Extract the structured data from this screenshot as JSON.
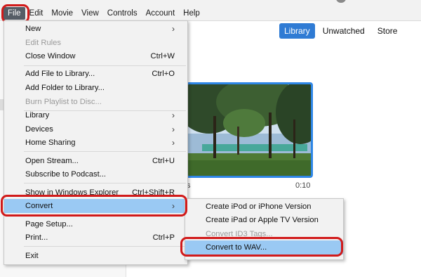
{
  "menubar": {
    "items": [
      "File",
      "Edit",
      "Movie",
      "View",
      "Controls",
      "Account",
      "Help"
    ]
  },
  "library_nav": {
    "tabs": [
      "Library",
      "Unwatched",
      "Store"
    ],
    "active": "Library"
  },
  "video": {
    "title_fragment": "s",
    "duration": "0:10"
  },
  "file_menu": {
    "items": [
      {
        "label": "New",
        "shortcut": "",
        "submenu": true,
        "disabled": false
      },
      {
        "label": "Edit Rules",
        "shortcut": "",
        "submenu": false,
        "disabled": true
      },
      {
        "label": "Close Window",
        "shortcut": "Ctrl+W",
        "submenu": false,
        "disabled": false
      },
      {
        "label": "Add File to Library...",
        "shortcut": "Ctrl+O",
        "submenu": false,
        "disabled": false
      },
      {
        "label": "Add Folder to Library...",
        "shortcut": "",
        "submenu": false,
        "disabled": false
      },
      {
        "label": "Burn Playlist to Disc...",
        "shortcut": "",
        "submenu": false,
        "disabled": true
      },
      {
        "label": "Library",
        "shortcut": "",
        "submenu": true,
        "disabled": false
      },
      {
        "label": "Devices",
        "shortcut": "",
        "submenu": true,
        "disabled": false
      },
      {
        "label": "Home Sharing",
        "shortcut": "",
        "submenu": true,
        "disabled": false
      },
      {
        "label": "Open Stream...",
        "shortcut": "Ctrl+U",
        "submenu": false,
        "disabled": false
      },
      {
        "label": "Subscribe to Podcast...",
        "shortcut": "",
        "submenu": false,
        "disabled": false
      },
      {
        "label": "Show in Windows Explorer",
        "shortcut": "Ctrl+Shift+R",
        "submenu": false,
        "disabled": false
      },
      {
        "label": "Convert",
        "shortcut": "",
        "submenu": true,
        "disabled": false,
        "highlighted": true
      },
      {
        "label": "Page Setup...",
        "shortcut": "",
        "submenu": false,
        "disabled": false
      },
      {
        "label": "Print...",
        "shortcut": "Ctrl+P",
        "submenu": false,
        "disabled": false
      },
      {
        "label": "Exit",
        "shortcut": "",
        "submenu": false,
        "disabled": false
      }
    ],
    "submenu_arrow": "›"
  },
  "convert_submenu": {
    "items": [
      {
        "label": "Create iPod or iPhone Version",
        "disabled": false
      },
      {
        "label": "Create iPad or Apple TV Version",
        "disabled": false
      },
      {
        "label": "Convert ID3 Tags...",
        "disabled": true
      },
      {
        "label": "Convert to WAV...",
        "disabled": false,
        "highlighted": true
      }
    ]
  },
  "colors": {
    "menu_highlight": "#9ac9f3",
    "annotation_ring": "#d11a1a",
    "active_tab": "#2f7bd4",
    "thumbnail_border": "#2e86e6"
  }
}
